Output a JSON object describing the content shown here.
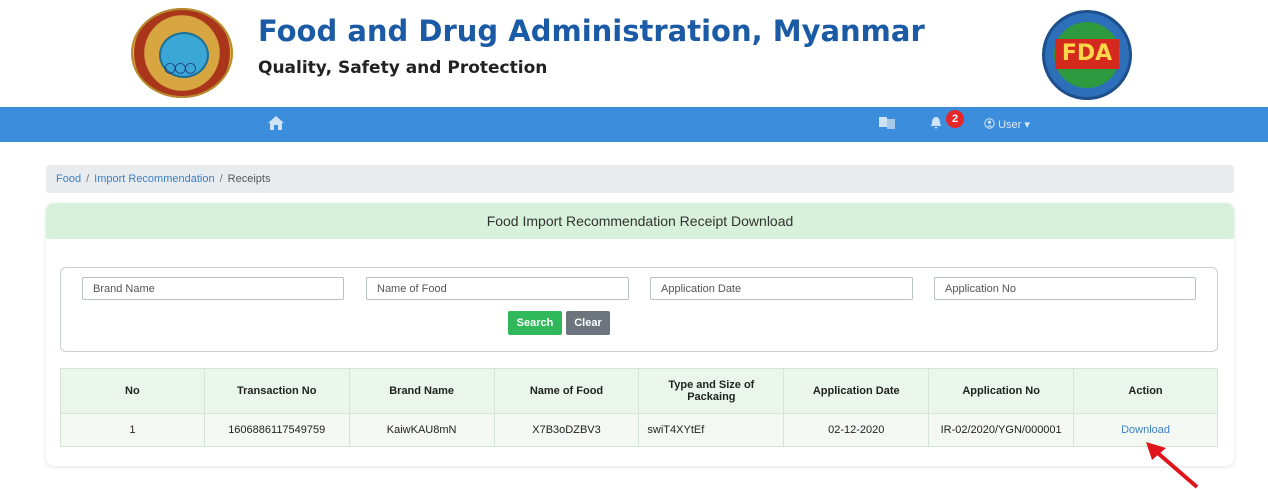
{
  "header": {
    "title": "Food and Drug Administration, Myanmar",
    "subtitle": "Quality, Safety and Protection",
    "right_logo_text": "FDA"
  },
  "navbar": {
    "notification_count": "2",
    "user_label": "User"
  },
  "breadcrumb": {
    "items": [
      "Food",
      "Import Recommendation"
    ],
    "current": "Receipts",
    "separator": "/"
  },
  "card": {
    "title": "Food Import Recommendation Receipt Download"
  },
  "search": {
    "brand_placeholder": "Brand Name",
    "food_placeholder": "Name of Food",
    "date_placeholder": "Application Date",
    "appno_placeholder": "Application No",
    "search_label": "Search",
    "clear_label": "Clear"
  },
  "table": {
    "columns": [
      "No",
      "Transaction No",
      "Brand Name",
      "Name of Food",
      "Type and Size of Packaing",
      "Application Date",
      "Application No",
      "Action"
    ],
    "rows": [
      {
        "no": "1",
        "transaction_no": "1606886117549759",
        "brand_name": "KaiwKAU8mN",
        "name_of_food": "X7B3oDZBV3",
        "packaging": "swiT4XYtEf",
        "application_date": "02-12-2020",
        "application_no": "IR-02/2020/YGN/000001",
        "action": "Download"
      }
    ]
  },
  "colors": {
    "navbar": "#3c8ddb",
    "card_header": "#d7f1da",
    "search_button": "#2fb95a",
    "clear_button": "#6c757d",
    "badge": "#e8262b",
    "link": "#3c7fc4",
    "annotation_arrow": "#e0141b"
  },
  "icons": {
    "home": "home-icon",
    "language": "language-icon",
    "bell": "bell-icon",
    "user": "user-circle-icon"
  }
}
